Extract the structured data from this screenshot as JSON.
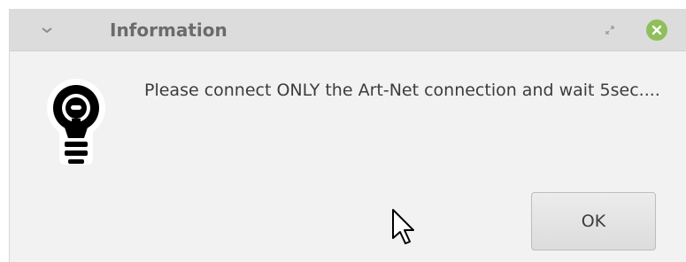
{
  "window": {
    "title": "Information",
    "message": "Please connect ONLY the Art-Net connection and wait 5sec....",
    "ok_label": "OK"
  },
  "icons": {
    "menu": "chevron-down-icon",
    "restore": "restore-icon",
    "close": "close-icon",
    "message": "lightbulb-icon",
    "cursor": "mouse-pointer-icon"
  },
  "colors": {
    "titlebar_bg": "#dcdcdc",
    "title_text": "#6b6b6b",
    "close_button": "#8fbf5a",
    "dialog_bg": "#f2f2f2",
    "message_text": "#3c3c3c"
  }
}
